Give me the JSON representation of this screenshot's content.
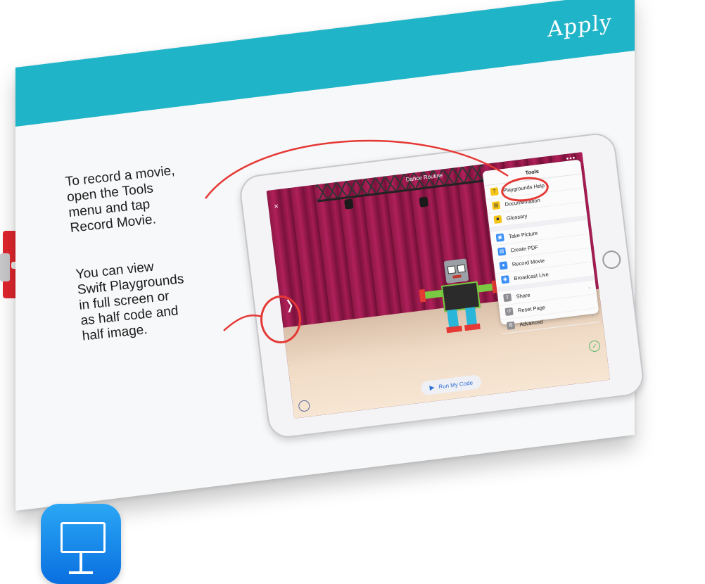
{
  "slide": {
    "title": "Apply",
    "band_color": "#1fb4c7",
    "note_record": "To record a movie,\nopen the Tools\nmenu and tap\nRecord Movie.",
    "note_view": "You can view\nSwift Playgrounds\nin full screen or\nas half code and\nhalf image."
  },
  "ipad": {
    "nav_title": "Dance Routine",
    "close_icon": "×",
    "more_icon": "•••",
    "chevron_icon": "❭",
    "run_button_label": "Run My Code",
    "tools_menu": {
      "header": "Tools",
      "items": [
        {
          "label": "Playgrounds Help",
          "icon": "?",
          "icon_color": "#f5c518"
        },
        {
          "label": "Documentation",
          "icon": "▤",
          "icon_color": "#f5c518"
        },
        {
          "label": "Glossary",
          "icon": "■",
          "icon_color": "#f5c518"
        },
        {
          "label": "Take Picture",
          "icon": "▣",
          "icon_color": "#3a8ef6"
        },
        {
          "label": "Create PDF",
          "icon": "▤",
          "icon_color": "#3a8ef6"
        },
        {
          "label": "Record Movie",
          "icon": "●",
          "icon_color": "#3a8ef6"
        },
        {
          "label": "Broadcast Live",
          "icon": "◉",
          "icon_color": "#3a8ef6"
        },
        {
          "label": "Share",
          "icon": "⇪",
          "icon_color": "#8e8e93"
        },
        {
          "label": "Reset Page",
          "icon": "↺",
          "icon_color": "#8e8e93"
        },
        {
          "label": "Advanced",
          "icon": "⚙",
          "icon_color": "#8e8e93"
        }
      ]
    }
  },
  "colors": {
    "annotation": "#e53935",
    "keynote_blue": "#0a6fe0"
  }
}
